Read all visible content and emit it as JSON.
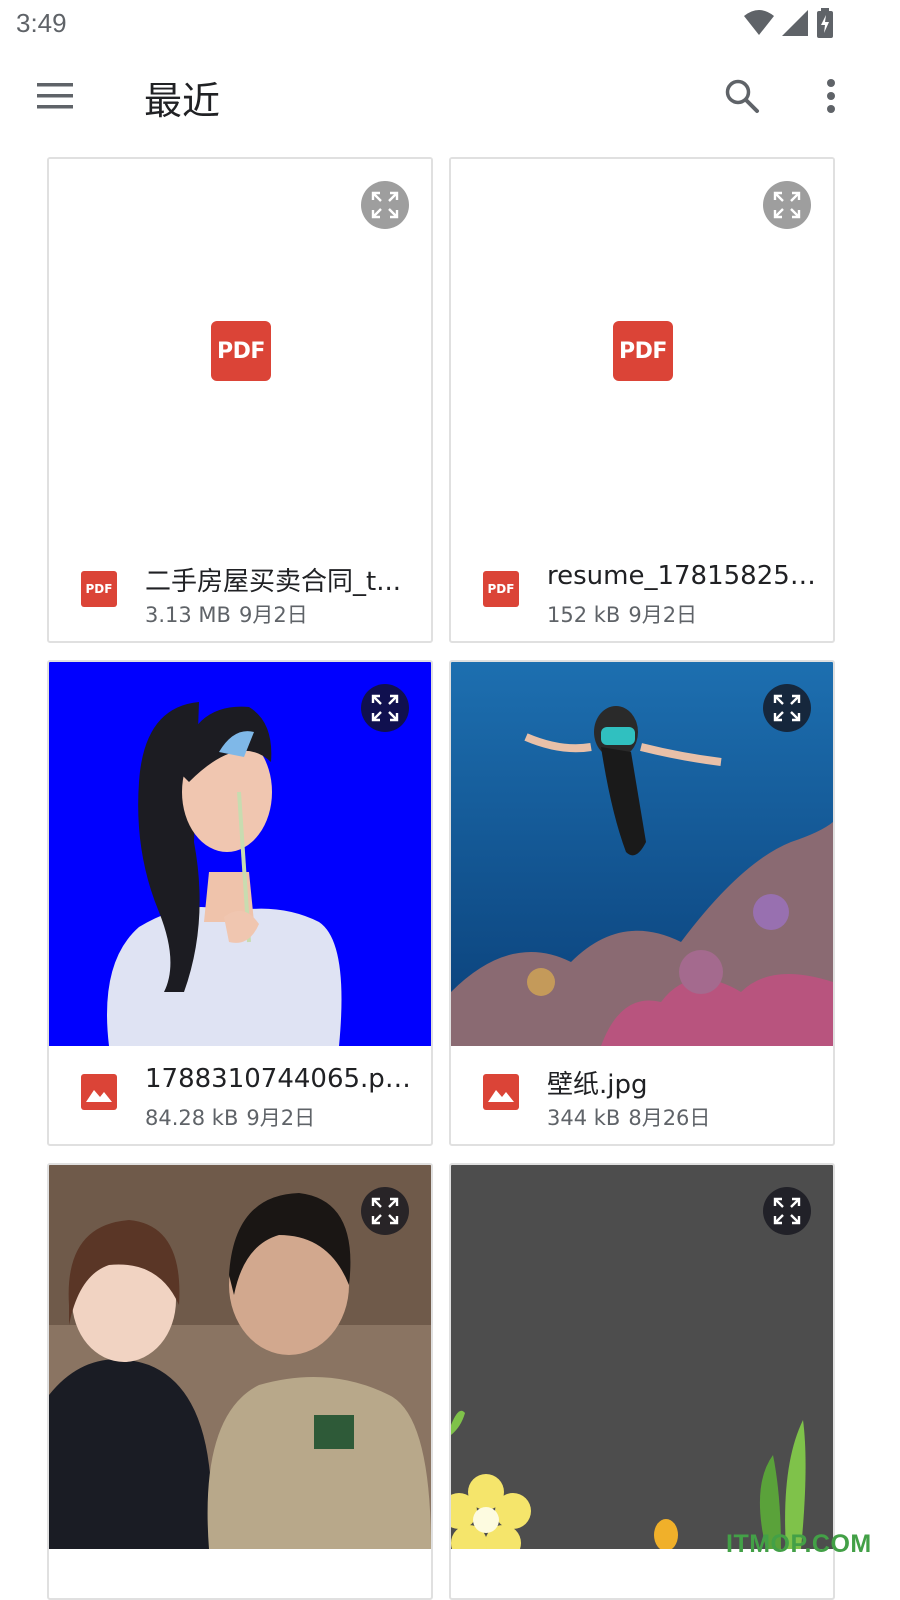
{
  "status_bar": {
    "time": "3:49",
    "icons": [
      "wifi-icon",
      "signal-icon",
      "battery-charging-icon"
    ]
  },
  "app_bar": {
    "title": "最近",
    "icons": [
      "menu-icon",
      "search-icon",
      "more-vert-icon"
    ]
  },
  "colors": {
    "pdf_red": "#db4437",
    "image_red": "#db4437",
    "card_border": "#e0e0e0",
    "watermark": "#43a047"
  },
  "files": [
    {
      "name": "二手房屋买卖合同_t...",
      "size": "3.13 MB",
      "date": "9月2日",
      "type": "pdf",
      "icon": "pdf-icon"
    },
    {
      "name": "resume_178158251...",
      "size": "152 kB",
      "date": "9月2日",
      "type": "pdf",
      "icon": "pdf-icon"
    },
    {
      "name": "1788310744065.png",
      "size": "84.28 kB",
      "date": "9月2日",
      "type": "image",
      "icon": "image-icon"
    },
    {
      "name": "壁纸.jpg",
      "size": "344 kB",
      "date": "8月26日",
      "type": "image",
      "icon": "image-icon"
    },
    {
      "name": "",
      "size": "",
      "date": "",
      "type": "image",
      "icon": "image-icon"
    },
    {
      "name": "",
      "size": "",
      "date": "",
      "type": "image",
      "icon": "image-icon"
    }
  ],
  "pdf_badge": "PDF",
  "watermark": "ITMOP.COM"
}
